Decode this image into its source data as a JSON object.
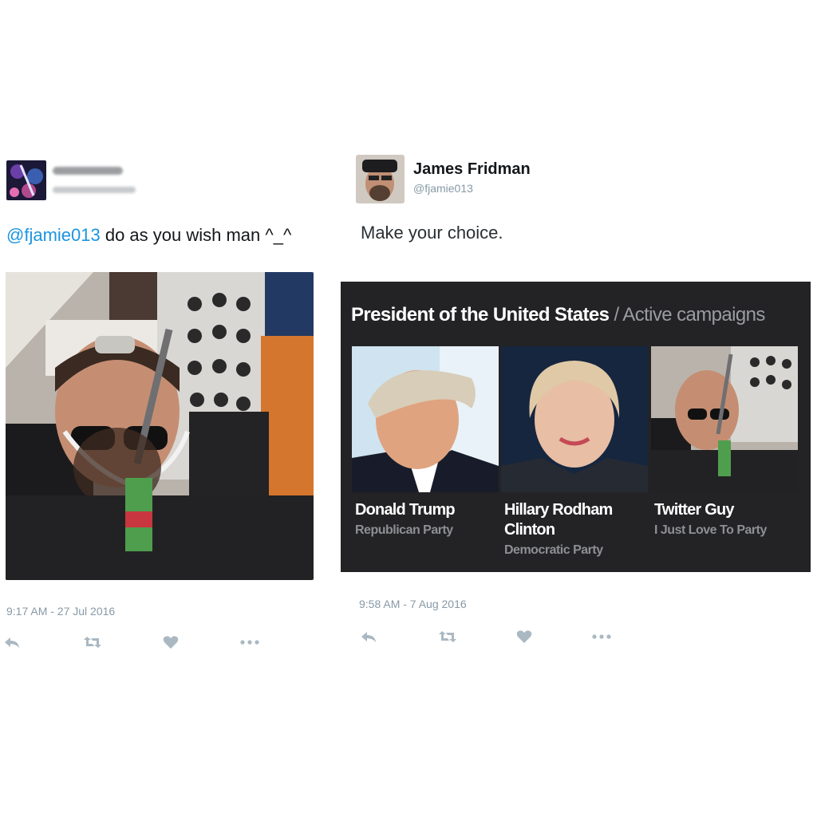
{
  "left_tweet": {
    "mention": "@fjamie013",
    "text": " do as you wish man ^_^",
    "timestamp": "9:17 AM - 27 Jul 2016"
  },
  "right_tweet": {
    "name": "James Fridman",
    "handle": "@fjamie013",
    "text": "Make your choice.",
    "timestamp": "9:58 AM - 7 Aug 2016"
  },
  "ballot": {
    "title": "President of the United States",
    "separator": " / ",
    "subtitle": "Active campaigns",
    "candidates": [
      {
        "name": "Donald Trump",
        "party": "Republican Party"
      },
      {
        "name": "Hillary Rodham Clinton",
        "party": "Democratic Party"
      },
      {
        "name": "Twitter Guy",
        "party": "I Just Love To Party"
      }
    ]
  },
  "icons": [
    "reply-icon",
    "retweet-icon",
    "like-icon",
    "more-icon"
  ],
  "colors": {
    "mention": "#1b95e0",
    "meta": "#8899a6",
    "card_bg": "#232325",
    "icon": "#aab8c2"
  }
}
